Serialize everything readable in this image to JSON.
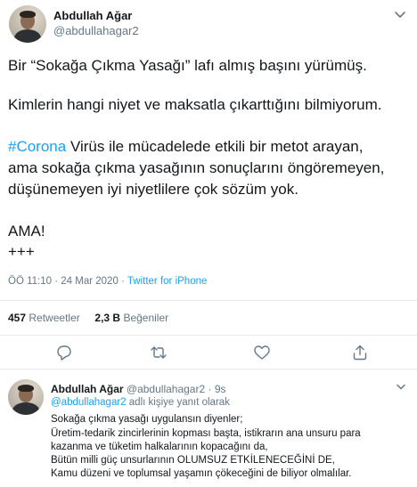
{
  "tweet": {
    "author_name": "Abdullah Ağar",
    "author_handle": "@abdullahagar2",
    "lines": [
      "Bir “Sokağa Çıkma Yasağı” lafı almış başını yürümüş.",
      "Kimlerin hangi niyet ve maksatla çıkarttığını bilmiyorum.",
      "Virüs ile mücadelede etkili bir metot arayan,",
      "ama sokağa çıkma yasağının sonuçlarını öngöremeyen,",
      "düşünemeyen iyi niyetlilere çok sözüm yok.",
      "AMA!",
      "+++"
    ],
    "hashtag": "#Corona",
    "time": "ÖÖ 11:10",
    "separator": "·",
    "date": "24 Mar 2020",
    "source": "Twitter for iPhone",
    "retweets_count": "457",
    "retweets_label": "Retweetler",
    "likes_count": "2,3 B",
    "likes_label": "Beğeniler"
  },
  "actions": [
    "reply-icon",
    "retweet-icon",
    "like-icon",
    "share-icon"
  ],
  "reply": {
    "author_name": "Abdullah Ağar",
    "author_handle": "@abdullahagar2",
    "dot": "·",
    "time": "9s",
    "reply_to_mention": "@abdullahagar2",
    "reply_to_suffix": "adlı kişiye yanıt olarak",
    "lines": [
      "Sokağa çıkma yasağı uygulansın diyenler;",
      "Üretim-tedarik zincirlerinin kopması başta, istikrarın ana unsuru para",
      "kazanma ve tüketim halkalarının kopacağını da,",
      "Bütün milli güç unsurlarının OLUMSUZ ETKİLENECEĞİNİ DE,",
      "Kamu düzeni ve toplumsal yaşamın çökeceğini de biliyor olmalılar."
    ]
  },
  "colors": {
    "text": "#14171a",
    "secondary": "#657786",
    "link": "#1da1f2",
    "divider": "#e6ecf0"
  }
}
